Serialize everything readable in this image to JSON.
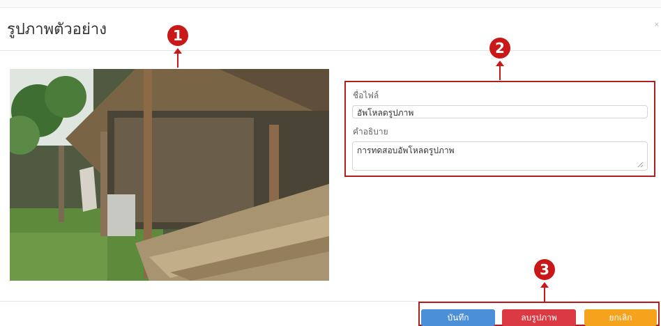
{
  "modal": {
    "title": "รูปภาพตัวอย่าง",
    "close": "×"
  },
  "markers": [
    "1",
    "2",
    "3"
  ],
  "form": {
    "filename_label": "ชื่อไฟล์",
    "filename_value": "อัพโหลดรูปภาพ",
    "description_label": "คำอธิบาย",
    "description_value": "การทดสอบอัพโหลดรูปภาพ"
  },
  "buttons": {
    "save": "บันทึก",
    "delete": "ลบรูปภาพ",
    "cancel": "ยกเลิก"
  },
  "colors": {
    "marker": "#c81818",
    "highlight_border": "#b21e1e",
    "save": "#4a8fd8",
    "delete": "#dc3a42",
    "cancel": "#f5a21c"
  }
}
